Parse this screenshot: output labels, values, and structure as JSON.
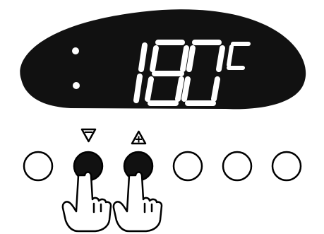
{
  "display": {
    "temperature": "180",
    "unit": "C"
  },
  "controls": {
    "minus_symbol": "−",
    "plus_symbol": "+",
    "buttons": [
      {
        "name": "button-1",
        "pressed": false
      },
      {
        "name": "decrease-button",
        "pressed": true
      },
      {
        "name": "increase-button",
        "pressed": true
      },
      {
        "name": "button-4",
        "pressed": false
      },
      {
        "name": "button-5",
        "pressed": false
      },
      {
        "name": "button-6",
        "pressed": false
      }
    ]
  },
  "icons": {
    "minus": "minus-triangle-icon",
    "plus": "plus-triangle-icon",
    "finger": "finger-press-icon"
  },
  "colors": {
    "display_background": "#111111",
    "segment": "#ffffff",
    "line": "#000000",
    "background": "#ffffff"
  }
}
